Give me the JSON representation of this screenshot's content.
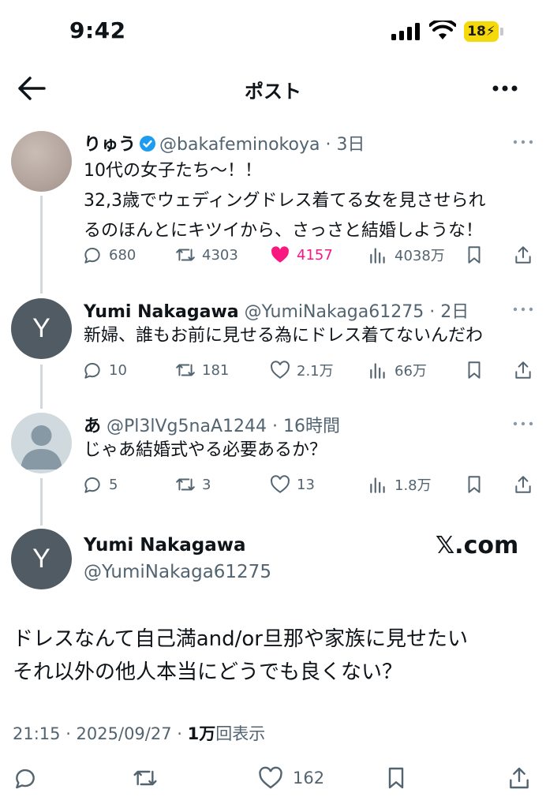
{
  "status_bar": {
    "time": "9:42",
    "battery": "18"
  },
  "header": {
    "title": "ポスト"
  },
  "tweets": [
    {
      "name": "りゅう",
      "handle": "@bakafeminokoya",
      "age": "3日",
      "lines": [
        "10代の女子たち〜！！",
        "32,3歳でウェディングドレス着てる女を見させられ",
        "るのほんとにキツイから、さっさと結婚しような！"
      ],
      "replies": "680",
      "reposts": "4303",
      "likes": "4157",
      "views": "4038万"
    },
    {
      "name": "Yumi Nakagawa",
      "handle": "@YumiNakaga61275",
      "age": "2日",
      "avatar_letter": "Y",
      "lines": [
        "新婦、誰もお前に見せる為にドレス着てないんだわ"
      ],
      "replies": "10",
      "reposts": "181",
      "likes": "2.1万",
      "views": "66万"
    },
    {
      "name": "あ",
      "handle": "@Pl3lVg5naA1244",
      "age": "16時間",
      "lines": [
        "じゃあ結婚式やる必要あるか？"
      ],
      "replies": "5",
      "reposts": "3",
      "likes": "13",
      "views": "1.8万"
    }
  ],
  "main_tweet": {
    "name": "Yumi Nakagawa",
    "handle": "@YumiNakaga61275",
    "avatar_letter": "Y",
    "source_badge": "𝕏.com",
    "lines": [
      "ドレスなんて自己満and/or旦那や家族に見せたい",
      "それ以外の他人本当にどうでも良くない？"
    ],
    "time_date": "21:15 · 2025/09/27 · ",
    "views": "1万",
    "views_suffix": "回表示",
    "likes": "162"
  },
  "colors": {
    "accent": "#1d9bf0",
    "like": "#f91880",
    "muted": "#536471",
    "thread_line": "#cfd9de"
  },
  "icons": [
    "back-arrow-icon",
    "more-icon",
    "verified-badge-icon",
    "reply-icon",
    "repost-icon",
    "like-icon",
    "views-icon",
    "bookmark-icon",
    "share-icon"
  ]
}
